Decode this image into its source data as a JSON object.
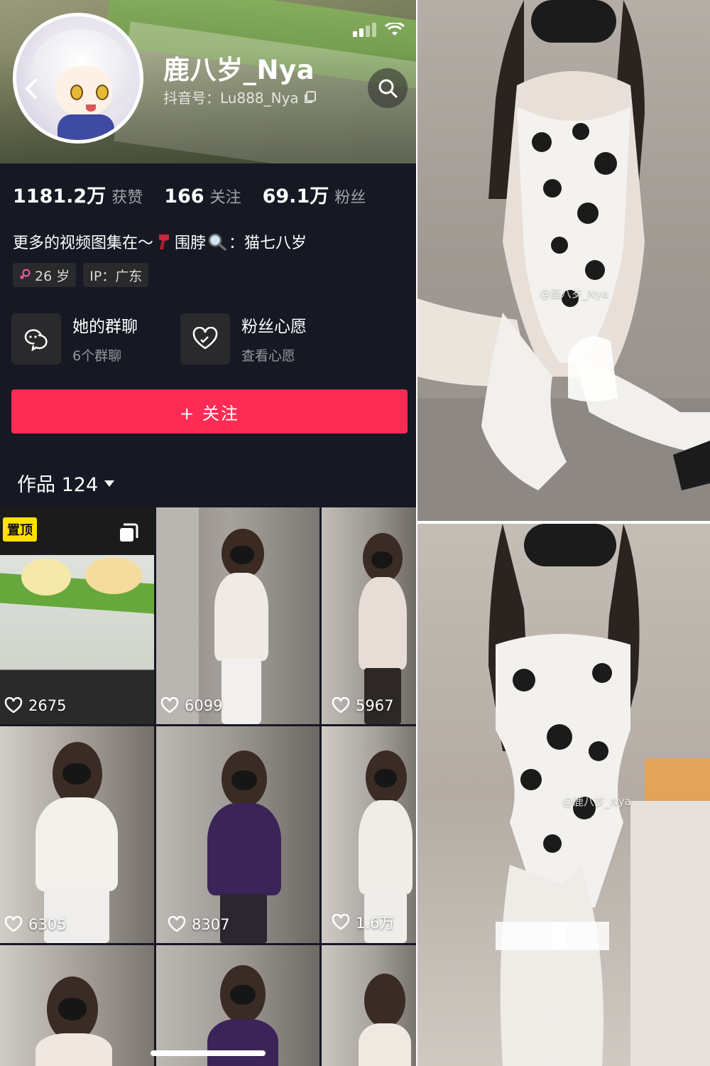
{
  "profile": {
    "nickname": "鹿八岁_Nya",
    "handle": "抖音号：Lu888_Nya",
    "stats": [
      {
        "num": "1181.2万",
        "label": "获赞"
      },
      {
        "num": "166",
        "label": "关注"
      },
      {
        "num": "69.1万",
        "label": "粉丝"
      }
    ],
    "bio_prefix": "更多的视频图集在～",
    "bio_mid": "围脖",
    "bio_suffix": "：猫七八岁",
    "tags": {
      "age": "26 岁",
      "ip": "IP：广东"
    },
    "features": [
      {
        "title": "她的群聊",
        "subtitle": "6个群聊"
      },
      {
        "title": "粉丝心愿",
        "subtitle": "查看心愿"
      }
    ],
    "follow_label": "+ 关注",
    "works_label": "作品 124"
  },
  "grid": {
    "pin_label": "置顶",
    "items": [
      {
        "likes": "2675"
      },
      {
        "likes": "6099"
      },
      {
        "likes": "5967"
      },
      {
        "likes": "6305"
      },
      {
        "likes": "8307"
      },
      {
        "likes": "1.6万"
      },
      {
        "likes": ""
      },
      {
        "likes": ""
      },
      {
        "likes": ""
      }
    ]
  },
  "photos": {
    "watermark_top": "@鹿八岁_Nya",
    "watermark_bottom": "@鹿八岁_Nya"
  },
  "colors": {
    "follow": "#fe2c55",
    "background": "#161823",
    "pin": "#ffe100"
  },
  "icons": {
    "back": "chevron-left-icon",
    "search": "search-icon",
    "group_chat": "chat-bubbles-icon",
    "wish": "heart-gift-icon",
    "like": "heart-outline-icon",
    "multi": "multi-image-icon",
    "dropdown": "caret-down-icon",
    "copy": "copy-icon",
    "gender": "female-icon"
  }
}
